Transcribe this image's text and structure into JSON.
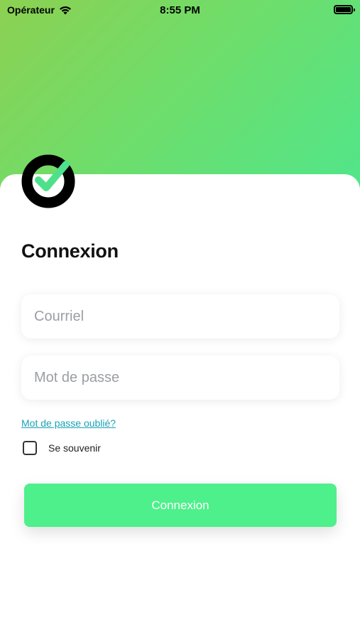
{
  "status_bar": {
    "carrier": "Opérateur",
    "time": "8:55 PM"
  },
  "login": {
    "title": "Connexion",
    "email_placeholder": "Courriel",
    "password_placeholder": "Mot de passe",
    "forgot_password": "Mot de passe oublié?",
    "remember_label": "Se souvenir",
    "remember_checked": false,
    "submit_label": "Connexion"
  },
  "colors": {
    "accent": "#4ef08b",
    "link": "#1aa3b6",
    "gradient_start": "#8cd152",
    "gradient_end": "#4fe68c"
  },
  "icons": [
    "wifi-icon",
    "battery-icon",
    "checkmark-logo-icon"
  ]
}
